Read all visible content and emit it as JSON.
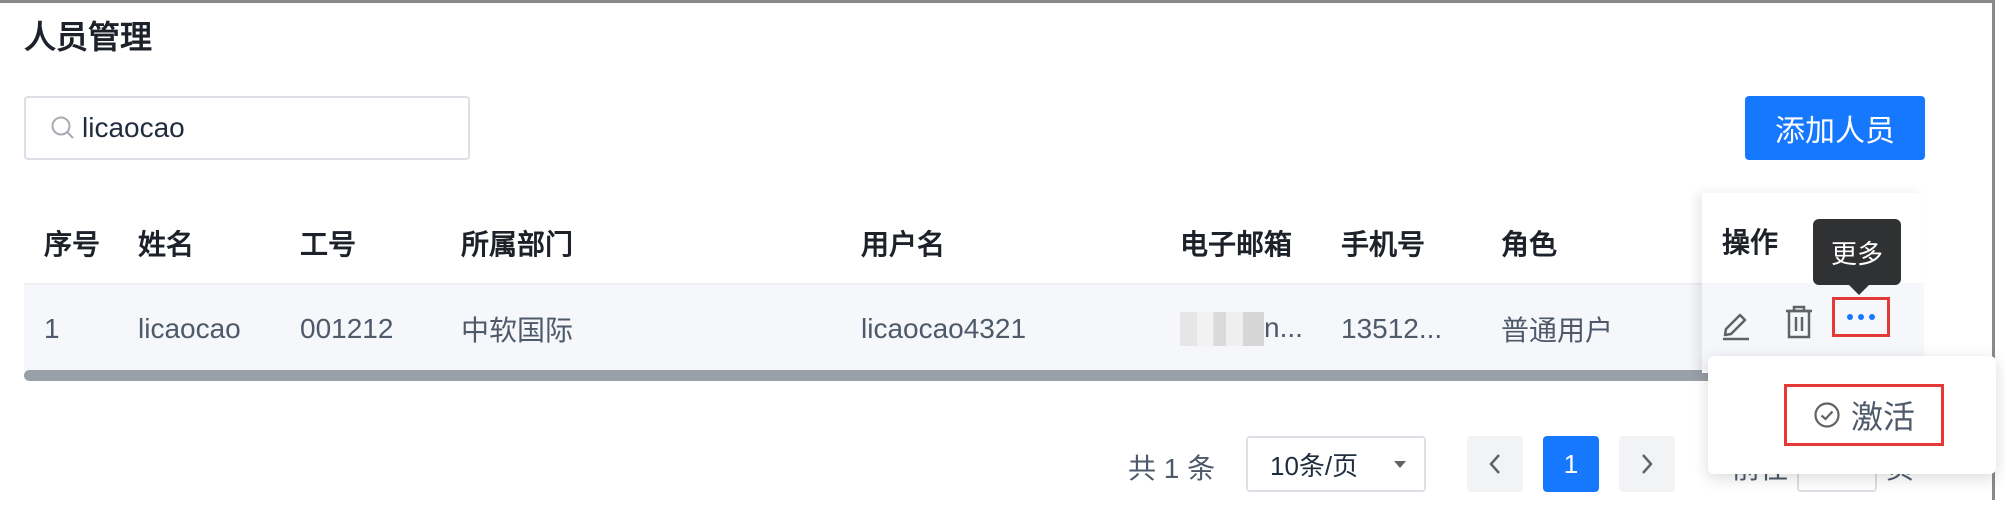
{
  "page": {
    "title": "人员管理"
  },
  "search": {
    "value": "licaocao",
    "icon": "search-icon"
  },
  "toolbar": {
    "add_label": "添加人员"
  },
  "table": {
    "columns": [
      "序号",
      "姓名",
      "工号",
      "所属部门",
      "用户名",
      "电子邮箱",
      "手机号",
      "角色",
      "操作"
    ],
    "rows": [
      {
        "index": "1",
        "name": "licaocao",
        "employee_id": "001212",
        "department": "中软国际",
        "username": "licaocao4321",
        "email_tail": "n...",
        "phone": "13512...",
        "role": "普通用户"
      }
    ]
  },
  "actions": {
    "tooltip": "更多",
    "dropdown_item": "激活"
  },
  "pagination": {
    "total": "共 1 条",
    "page_size": "10条/页",
    "current_page": "1",
    "goto_prefix": "前往",
    "goto_suffix": "页"
  },
  "colors": {
    "primary": "#1677ff",
    "highlight": "#e53935",
    "tooltip_bg": "#303133"
  }
}
